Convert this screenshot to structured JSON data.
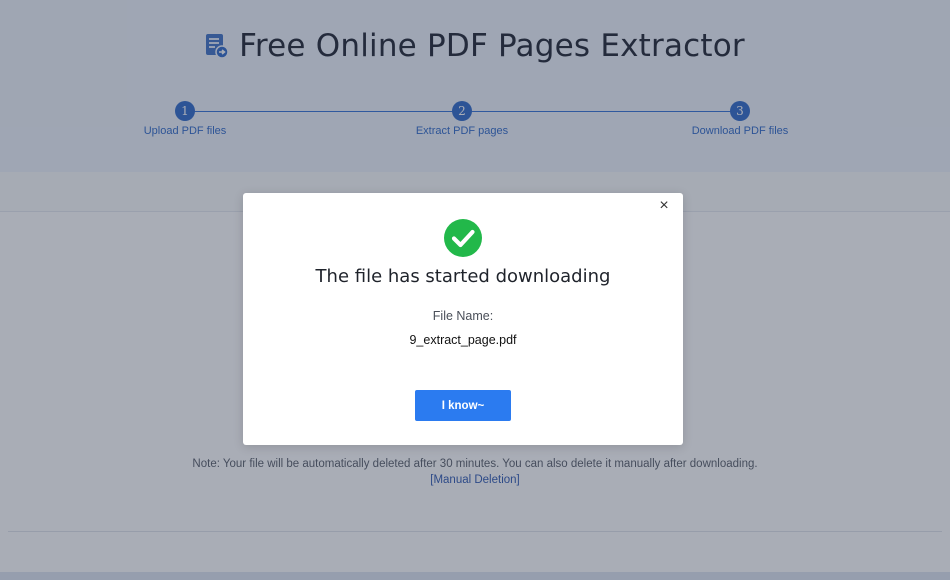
{
  "header": {
    "icon": "pdf-extract-icon",
    "title": "Free Online PDF Pages Extractor"
  },
  "steps": [
    {
      "number": "1",
      "label": "Upload PDF files"
    },
    {
      "number": "2",
      "label": "Extract PDF pages"
    },
    {
      "number": "3",
      "label": "Download PDF files"
    }
  ],
  "main": {
    "note": "Note: Your file will be automatically deleted after 30 minutes. You can also delete it manually after downloading.",
    "manual_deletion_link": "[Manual Deletion]"
  },
  "modal": {
    "icon": "check-circle-icon",
    "close_symbol": "×",
    "title": "The file has started downloading",
    "file_label": "File Name:",
    "file_name": "9_extract_page.pdf",
    "ok_label": "I know~"
  },
  "colors": {
    "accent": "#2b7bf0",
    "step": "#2a66c9",
    "success": "#22b84a"
  }
}
